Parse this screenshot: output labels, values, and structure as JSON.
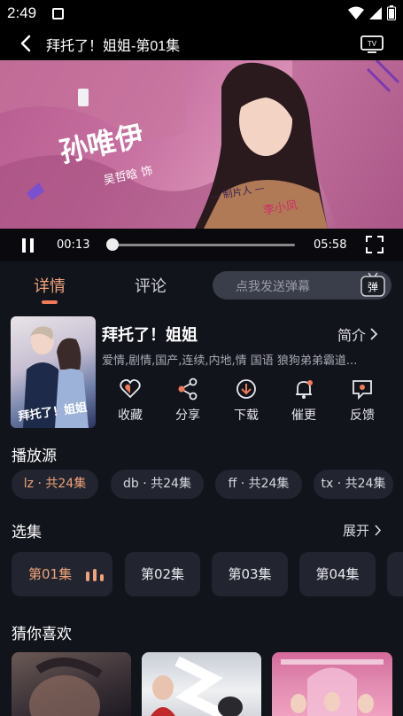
{
  "status": {
    "time": "2:49"
  },
  "header": {
    "title": "拜托了！姐姐-第01集"
  },
  "player": {
    "current_time": "00:13",
    "duration": "05:58",
    "progress": 0.01,
    "overlay_name": "孙唯伊",
    "overlay_actor": "吴哲晗 饰",
    "overlay_credit_label": "— 制片人 —",
    "overlay_credit_name": "李小凤"
  },
  "tabs": [
    {
      "label": "详情"
    },
    {
      "label": "评论"
    }
  ],
  "danmu": {
    "placeholder": "点我发送弹幕",
    "icon_text": "弹"
  },
  "show": {
    "title": "拜托了！姐姐",
    "intro_label": "简介",
    "tags": "爱情,剧情,国产,连续,内地,情 国语 狼狗弟弟霸道...",
    "poster_text": "拜托了！姐姐"
  },
  "actions": [
    {
      "label": "收藏",
      "icon": "heart-icon"
    },
    {
      "label": "分享",
      "icon": "share-icon"
    },
    {
      "label": "下载",
      "icon": "download-icon"
    },
    {
      "label": "催更",
      "icon": "bell-icon"
    },
    {
      "label": "反馈",
      "icon": "feedback-icon"
    }
  ],
  "sources": {
    "title": "播放源",
    "items": [
      {
        "label": "lz · 共24集"
      },
      {
        "label": "db · 共24集"
      },
      {
        "label": "ff · 共24集"
      },
      {
        "label": "tx · 共24集"
      }
    ]
  },
  "episodes": {
    "title": "选集",
    "expand_label": "展开",
    "items": [
      {
        "label": "第01集"
      },
      {
        "label": "第02集"
      },
      {
        "label": "第03集"
      },
      {
        "label": "第04集"
      }
    ]
  },
  "recommend": {
    "title": "猜你喜欢"
  },
  "colors": {
    "accent": "#f0a27a",
    "background": "#12141c",
    "card": "#22252f"
  }
}
